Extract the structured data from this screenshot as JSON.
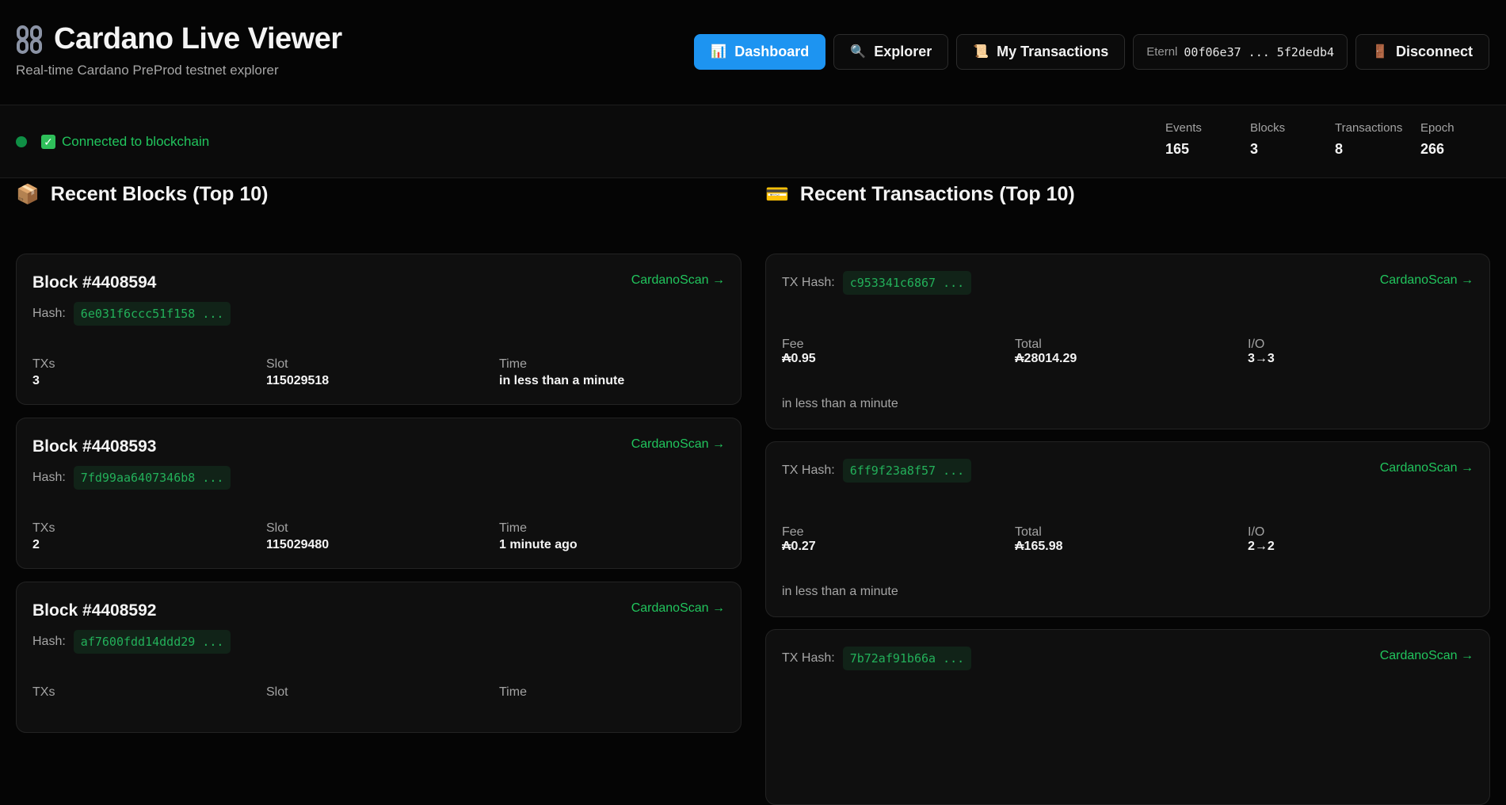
{
  "header": {
    "title": "Cardano Live Viewer",
    "subtitle": "Real-time Cardano PreProd testnet explorer",
    "nav": {
      "dashboard": {
        "icon": "📊",
        "label": "Dashboard"
      },
      "explorer": {
        "icon": "🔍",
        "label": "Explorer"
      },
      "my_transactions": {
        "icon": "📜",
        "label": "My Transactions"
      },
      "disconnect": {
        "icon": "🚪",
        "label": "Disconnect"
      }
    },
    "wallet": {
      "name": "Eternl",
      "address": "00f06e37 ... 5f2dedb4"
    }
  },
  "status": {
    "connection_text": "Connected to blockchain",
    "stats": [
      {
        "label": "Events",
        "value": "165"
      },
      {
        "label": "Blocks",
        "value": "3"
      },
      {
        "label": "Transactions",
        "value": "8"
      },
      {
        "label": "Epoch",
        "value": "266"
      }
    ]
  },
  "blocks_section": {
    "icon": "📦",
    "title": "Recent Blocks (Top 10)",
    "hash_label": "Hash:",
    "link_label": "CardanoScan →",
    "field_labels": {
      "txs": "TXs",
      "slot": "Slot",
      "time": "Time"
    },
    "items": [
      {
        "title": "Block #4408594",
        "hash": "6e031f6ccc51f158 ...",
        "txs": "3",
        "slot": "115029518",
        "time": "in less than a minute"
      },
      {
        "title": "Block #4408593",
        "hash": "7fd99aa6407346b8 ...",
        "txs": "2",
        "slot": "115029480",
        "time": "1 minute ago"
      },
      {
        "title": "Block #4408592",
        "hash": "af7600fdd14ddd29 ...",
        "txs": "",
        "slot": "",
        "time": ""
      }
    ]
  },
  "tx_section": {
    "icon": "💳",
    "title": "Recent Transactions (Top 10)",
    "hash_label": "TX Hash:",
    "link_label": "CardanoScan →",
    "field_labels": {
      "fee": "Fee",
      "total": "Total",
      "io": "I/O"
    },
    "items": [
      {
        "hash": "c953341c6867 ...",
        "fee": "₳0.95",
        "total": "₳28014.29",
        "io": "3→3",
        "time": "in less than a minute"
      },
      {
        "hash": "6ff9f23a8f57 ...",
        "fee": "₳0.27",
        "total": "₳165.98",
        "io": "2→2",
        "time": "in less than a minute"
      },
      {
        "hash": "7b72af91b66a ...",
        "fee": "",
        "total": "",
        "io": "",
        "time": ""
      }
    ]
  },
  "colors": {
    "accent": "#1d94f1",
    "success": "#21c55d",
    "background": "#050505",
    "card": "#0f0f0f"
  }
}
